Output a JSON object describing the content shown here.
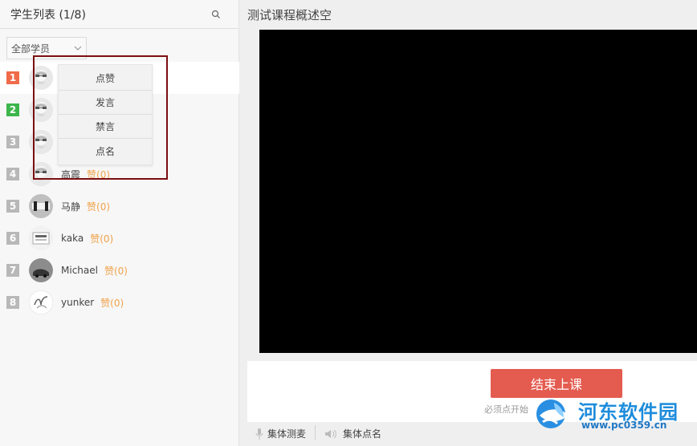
{
  "left_panel": {
    "title": "学生列表 (1/8)",
    "filter_label": "全部学员"
  },
  "students": [
    {
      "number": "1",
      "name": "",
      "likes": "",
      "badge_color": "#f06b4a",
      "avatar_icon": "avatar-glasses-icon",
      "active": true
    },
    {
      "number": "2",
      "name": "",
      "likes": "",
      "badge_color": "#3cb64a",
      "avatar_icon": "avatar-glasses-icon",
      "active": false
    },
    {
      "number": "3",
      "name": "",
      "likes": "",
      "badge_color": "#b8b8b8",
      "avatar_icon": "avatar-glasses-icon",
      "active": false
    },
    {
      "number": "4",
      "name": "高震",
      "likes": "赞(0)",
      "badge_color": "#b8b8b8",
      "avatar_icon": "avatar-glasses-icon",
      "active": false
    },
    {
      "number": "5",
      "name": "马静",
      "likes": "赞(0)",
      "badge_color": "#b8b8b8",
      "avatar_icon": "avatar-photo-icon",
      "active": false
    },
    {
      "number": "6",
      "name": "kaka",
      "likes": "赞(0)",
      "badge_color": "#b8b8b8",
      "avatar_icon": "avatar-device-icon",
      "active": false
    },
    {
      "number": "7",
      "name": "Michael",
      "likes": "赞(0)",
      "badge_color": "#b8b8b8",
      "avatar_icon": "avatar-car-icon",
      "active": false
    },
    {
      "number": "8",
      "name": "yunker",
      "likes": "赞(0)",
      "badge_color": "#b8b8b8",
      "avatar_icon": "avatar-signature-icon",
      "active": false
    }
  ],
  "context_menu": {
    "items": [
      "点赞",
      "发言",
      "禁言",
      "点名"
    ]
  },
  "right_panel": {
    "title": "测试课程概述空",
    "end_button": "结束上课",
    "note": "必须点开始",
    "bottom_buttons": [
      "集体测麦",
      "集体点名"
    ]
  },
  "watermark": {
    "title": "河东软件园",
    "url": "www.pc0359.cn"
  },
  "colors": {
    "accent": "#e45b4f",
    "likes": "#f0a24a",
    "highlight_border": "#7b0f12",
    "watermark_blue": "#1d8cdb"
  }
}
